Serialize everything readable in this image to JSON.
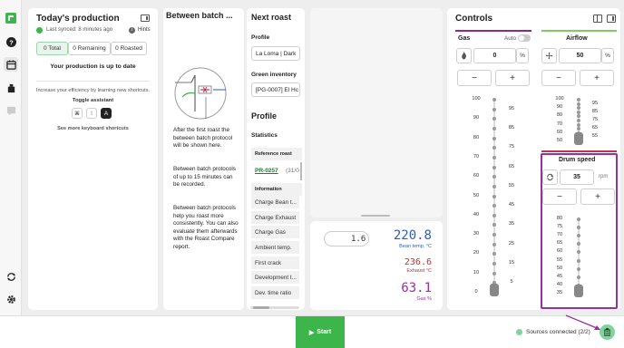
{
  "sidebar": {
    "icons": [
      "logo-icon",
      "help-icon",
      "production-icon",
      "roaster-icon",
      "chat-icon",
      "sync-icon",
      "settings-icon"
    ]
  },
  "production": {
    "title": "Today's production",
    "synced": "Last synced: 8 minutes ago",
    "hints": "Hints",
    "tabs": [
      "0 Total",
      "0 Remaining",
      "0 Roasted"
    ],
    "status": "Your production is up to date",
    "efficiency": "Increase your efficiency by learning new shortcuts.",
    "toggle_label": "Toggle assistant",
    "keys": [
      "⌘",
      "⇧",
      "A"
    ],
    "shortcuts_link": "See more keyboard shortcuts"
  },
  "between": {
    "title": "Between batch ...",
    "p1": "After the first roast the between batch protocol will be shown here.",
    "p2": "Between batch protocols of up to 15 minutes can be recorded.",
    "p3": "Between batch protocols help you roast more consistently. You can also evaluate them afterwards with the Roast Compare report."
  },
  "next_roast": {
    "title": "Next roast",
    "profile_label": "Profile",
    "profile_value": "La Loma | Dark",
    "green_label": "Green inventory",
    "green_value": "[PG-0007] El Hc",
    "profile_heading": "Profile",
    "statistics": "Statistics",
    "reference_roast": "Reference roast",
    "reference_link": "PR-0257",
    "reference_date": "(31/0",
    "information": "Information",
    "items": [
      "Charge Bean t...",
      "Charge Exhaust",
      "Charge Gas",
      "Ambient temp.",
      "First crack",
      "Development t...",
      "Dev. time ratio"
    ]
  },
  "readout": {
    "ror": "1.6",
    "bean_temp": "220.8",
    "bean_label": "Bean temp. °C",
    "exhaust_temp": "236.6",
    "exhaust_label": "Exhaust °C",
    "gas": "63.1",
    "gas_label": "Gas %"
  },
  "controls": {
    "title": "Controls",
    "gas": {
      "label": "Gas",
      "auto": "Auto",
      "value": "0",
      "unit": "%",
      "minus": "−",
      "plus": "+",
      "scale_left": [
        "100",
        "90",
        "80",
        "70",
        "60",
        "50",
        "40",
        "30",
        "20",
        "10",
        "0"
      ],
      "scale_right": [
        "95",
        "85",
        "75",
        "65",
        "55",
        "45",
        "35",
        "25",
        "15",
        "5"
      ],
      "level": 0
    },
    "airflow": {
      "label": "Airflow",
      "value": "50",
      "unit": "%",
      "minus": "−",
      "plus": "+",
      "scale_left": [
        "100",
        "90",
        "80",
        "70",
        "60",
        "50"
      ],
      "scale_right": [
        "95",
        "85",
        "75",
        "65",
        "55"
      ],
      "level": 50
    },
    "drum": {
      "label": "Drum speed",
      "value": "35",
      "unit": "rpm",
      "minus": "−",
      "plus": "+",
      "scale": [
        "80",
        "75",
        "70",
        "65",
        "60",
        "55",
        "50",
        "45",
        "40",
        "35"
      ],
      "level": 35
    }
  },
  "footer": {
    "start": "Start",
    "sources": "Sources connected (2/2)"
  },
  "colors": {
    "brand_green": "#3cb54a",
    "gas_accent": "#8e2a8e",
    "airflow_accent": "#7ccf5f",
    "drum_accent": "#c0325a",
    "temp_blue": "#2b5fb5",
    "temp_red": "#c0322b",
    "highlight_purple": "#9b2fa0"
  }
}
